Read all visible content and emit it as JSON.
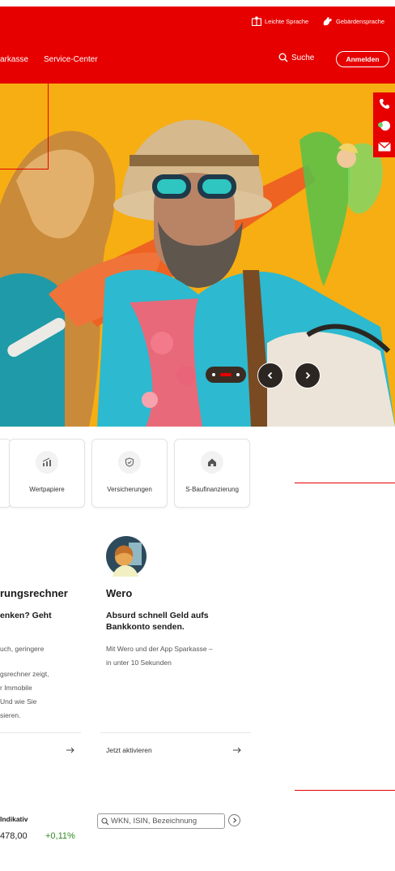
{
  "header": {
    "easy_language": "Leichte Sprache",
    "sign_language": "Gebärdensprache",
    "nav": [
      "arkasse",
      "Service-Center"
    ],
    "search_label": "Suche",
    "login_label": "Anmelden"
  },
  "hero": {
    "icon_names": [
      "chevron-left-icon",
      "chevron-right-icon"
    ]
  },
  "side_contact": {
    "icons": [
      "phone-icon",
      "chat-icon",
      "mail-icon"
    ]
  },
  "products": [
    {
      "label": "Wertpapiere",
      "icon": "chart-icon"
    },
    {
      "label": "Versicherungen",
      "icon": "shield-icon"
    },
    {
      "label": "S-Baufinanzierung",
      "icon": "house-icon"
    }
  ],
  "teasers": {
    "left": {
      "title": "rungsrechner",
      "subtitle": "enken? Geht",
      "body": [
        "uch, geringere",
        "",
        "gsrechner zeigt,",
        "r Immobile",
        "Und wie Sie",
        "sieren."
      ]
    },
    "right": {
      "title": "Wero",
      "subtitle": [
        "Absurd schnell Geld aufs",
        "Bankkonto senden."
      ],
      "body": [
        "Mit Wero und der App Sparkasse –",
        "in unter 10 Sekunden"
      ],
      "link": "Jetzt aktivieren"
    }
  },
  "market": {
    "label": "Indikativ",
    "value": "478,00",
    "change": "+0,11%",
    "change_color": "#2e8b1f",
    "search_placeholder": "WKN, ISIN, Bezeichnung"
  },
  "colors": {
    "brand": "#e60000",
    "hero_bg": "#f6ae12"
  }
}
